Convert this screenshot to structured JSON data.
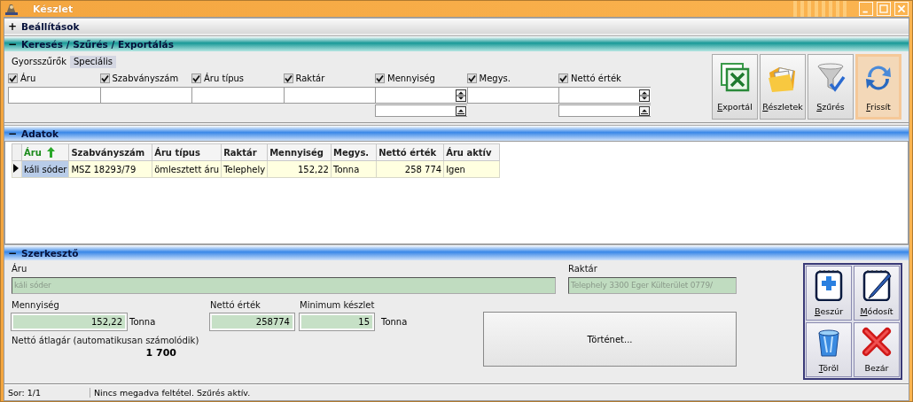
{
  "window": {
    "title": "Készlet"
  },
  "settings_header": {
    "toggle": "+",
    "title": "Beállítások",
    "kind": "plain"
  },
  "search_header": {
    "toggle": "−",
    "title": "Keresés / Szűrés / Exportálás",
    "kind": "teal"
  },
  "filter_tabs": [
    {
      "label": "Gyorsszűrők",
      "selected": true
    },
    {
      "label": "Speciális",
      "selected": false
    }
  ],
  "filters": [
    {
      "label": "Áru",
      "checked": true,
      "kind": "text"
    },
    {
      "label": "Szabványszám",
      "checked": true,
      "kind": "text"
    },
    {
      "label": "Áru típus",
      "checked": true,
      "kind": "text"
    },
    {
      "label": "Raktár",
      "checked": true,
      "kind": "text"
    },
    {
      "label": "Mennyiség",
      "checked": true,
      "kind": "range"
    },
    {
      "label": "Megys.",
      "checked": true,
      "kind": "text"
    },
    {
      "label": "Nettó érték",
      "checked": true,
      "kind": "range"
    }
  ],
  "toolbar": [
    {
      "label": "Exportál",
      "kind": "spreadsheet",
      "mnemonic": true,
      "focused": false
    },
    {
      "label": "Részletek",
      "kind": "folder",
      "mnemonic": true,
      "focused": false
    },
    {
      "label": "Szűrés",
      "kind": "funnel",
      "mnemonic": true,
      "focused": false
    },
    {
      "label": "Frissít",
      "kind": "refresh",
      "mnemonic": true,
      "focused": true
    }
  ],
  "data_header": {
    "toggle": "−",
    "title": "Adatok",
    "kind": "blue"
  },
  "table": {
    "columns": [
      {
        "label": "Áru",
        "sorted": true,
        "numeric": false
      },
      {
        "label": "Szabványszám",
        "sorted": false,
        "numeric": false
      },
      {
        "label": "Áru típus",
        "sorted": false,
        "numeric": false
      },
      {
        "label": "Raktár",
        "sorted": false,
        "numeric": false
      },
      {
        "label": "Mennyiség",
        "sorted": false,
        "numeric": true
      },
      {
        "label": "Megys.",
        "sorted": false,
        "numeric": false
      },
      {
        "label": "Nettó érték",
        "sorted": false,
        "numeric": true
      },
      {
        "label": "Áru aktív",
        "sorted": false,
        "numeric": false
      }
    ],
    "rows": [
      {
        "current": true,
        "cells": [
          {
            "text": "káli sóder",
            "selected": true
          },
          {
            "text": "MSZ 18293/79",
            "selected": false
          },
          {
            "text": "ömlesztett áru",
            "selected": false
          },
          {
            "text": "Telephely",
            "selected": false
          },
          {
            "text": "152,22",
            "selected": false
          },
          {
            "text": "Tonna",
            "selected": false
          },
          {
            "text": "258 774",
            "selected": false
          },
          {
            "text": "Igen",
            "selected": false
          }
        ]
      }
    ]
  },
  "editor_header": {
    "toggle": "−",
    "title": "Szerkesztő",
    "kind": "blue"
  },
  "editor": {
    "item": {
      "label": "Áru",
      "value": "káli sóder",
      "disabled": true
    },
    "warehouse": {
      "label": "Raktár",
      "value": "Telephely 3300 Eger Külterület 0779/",
      "disabled": true
    },
    "quantity": {
      "label": "Mennyiség",
      "value": "152,22",
      "unit": "Tonna"
    },
    "net_value": {
      "label": "Nettó érték",
      "value": "258774"
    },
    "min_stock": {
      "label": "Minimum készlet",
      "value": "15",
      "unit": "Tonna"
    },
    "avg_price": {
      "label": "Nettó átlagár (automatikusan számolódik)",
      "value": "1 700"
    },
    "history_button": "Történet..."
  },
  "actions": [
    {
      "label": "Beszúr",
      "kind": "note-plus",
      "mnemonic": true
    },
    {
      "label": "Módosít",
      "kind": "note-pen",
      "mnemonic": true
    },
    {
      "label": "Töröl",
      "kind": "bin",
      "mnemonic": true
    },
    {
      "label": "Bezár",
      "kind": "cross",
      "mnemonic": false
    }
  ],
  "status_bar": [
    "Sor: 1/1",
    "Nincs megadva feltétel. Szűrés aktív."
  ]
}
